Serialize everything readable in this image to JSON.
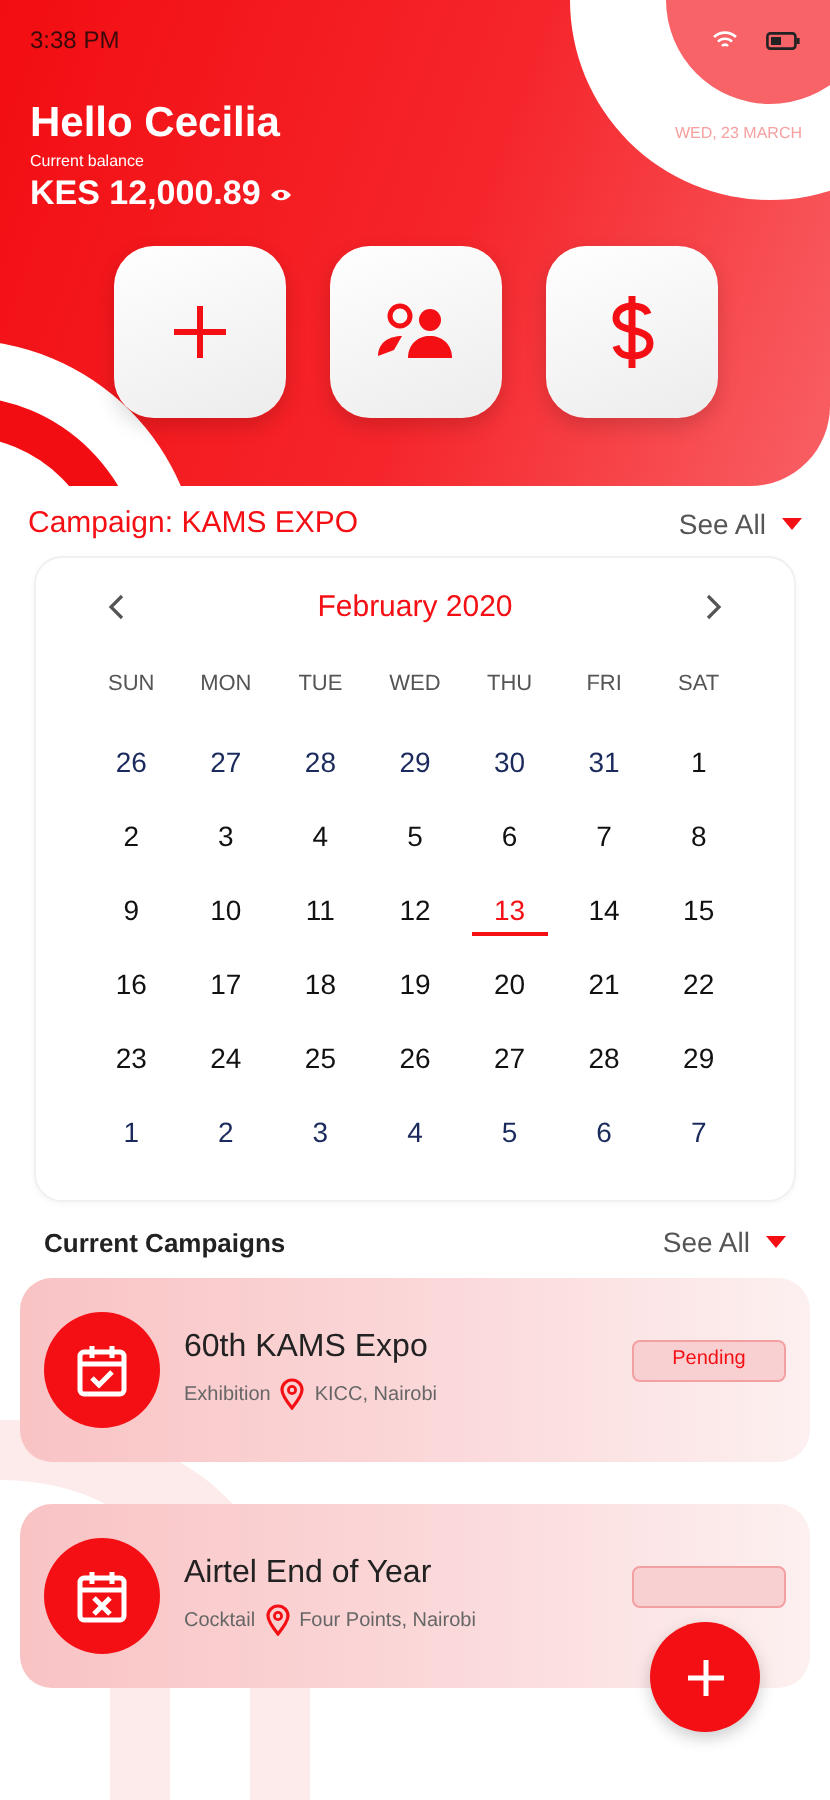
{
  "status_bar": {
    "time": "3:38 PM"
  },
  "header": {
    "greeting": "Hello Cecilia",
    "date": "WED, 23 MARCH",
    "balance_label": "Current balance",
    "balance": "KES 12,000.89"
  },
  "actions": [
    {
      "kind": "add"
    },
    {
      "kind": "people"
    },
    {
      "kind": "money"
    }
  ],
  "campaign": {
    "title": "Campaign: KAMS EXPO",
    "see_all": "See All"
  },
  "calendar": {
    "month": "February 2020",
    "weekdays": [
      "SUN",
      "MON",
      "TUE",
      "WED",
      "THU",
      "FRI",
      "SAT"
    ],
    "weeks": [
      [
        {
          "d": "26",
          "outside": true,
          "selected": false
        },
        {
          "d": "27",
          "outside": true,
          "selected": false
        },
        {
          "d": "28",
          "outside": true,
          "selected": false
        },
        {
          "d": "29",
          "outside": true,
          "selected": false
        },
        {
          "d": "30",
          "outside": true,
          "selected": false
        },
        {
          "d": "31",
          "outside": true,
          "selected": false
        },
        {
          "d": "1",
          "outside": false,
          "selected": false
        }
      ],
      [
        {
          "d": "2",
          "outside": false,
          "selected": false
        },
        {
          "d": "3",
          "outside": false,
          "selected": false
        },
        {
          "d": "4",
          "outside": false,
          "selected": false
        },
        {
          "d": "5",
          "outside": false,
          "selected": false
        },
        {
          "d": "6",
          "outside": false,
          "selected": false
        },
        {
          "d": "7",
          "outside": false,
          "selected": false
        },
        {
          "d": "8",
          "outside": false,
          "selected": false
        }
      ],
      [
        {
          "d": "9",
          "outside": false,
          "selected": false
        },
        {
          "d": "10",
          "outside": false,
          "selected": false
        },
        {
          "d": "11",
          "outside": false,
          "selected": false
        },
        {
          "d": "12",
          "outside": false,
          "selected": false
        },
        {
          "d": "13",
          "outside": false,
          "selected": true
        },
        {
          "d": "14",
          "outside": false,
          "selected": false
        },
        {
          "d": "15",
          "outside": false,
          "selected": false
        }
      ],
      [
        {
          "d": "16",
          "outside": false,
          "selected": false
        },
        {
          "d": "17",
          "outside": false,
          "selected": false
        },
        {
          "d": "18",
          "outside": false,
          "selected": false
        },
        {
          "d": "19",
          "outside": false,
          "selected": false
        },
        {
          "d": "20",
          "outside": false,
          "selected": false
        },
        {
          "d": "21",
          "outside": false,
          "selected": false
        },
        {
          "d": "22",
          "outside": false,
          "selected": false
        }
      ],
      [
        {
          "d": "23",
          "outside": false,
          "selected": false
        },
        {
          "d": "24",
          "outside": false,
          "selected": false
        },
        {
          "d": "25",
          "outside": false,
          "selected": false
        },
        {
          "d": "26",
          "outside": false,
          "selected": false
        },
        {
          "d": "27",
          "outside": false,
          "selected": false
        },
        {
          "d": "28",
          "outside": false,
          "selected": false
        },
        {
          "d": "29",
          "outside": false,
          "selected": false
        }
      ],
      [
        {
          "d": "1",
          "outside": true,
          "selected": false
        },
        {
          "d": "2",
          "outside": true,
          "selected": false
        },
        {
          "d": "3",
          "outside": true,
          "selected": false
        },
        {
          "d": "4",
          "outside": true,
          "selected": false
        },
        {
          "d": "5",
          "outside": true,
          "selected": false
        },
        {
          "d": "6",
          "outside": true,
          "selected": false
        },
        {
          "d": "7",
          "outside": true,
          "selected": false
        }
      ]
    ]
  },
  "current_campaigns": {
    "title": "Current Campaigns",
    "see_all": "See All",
    "items": [
      {
        "kind": "check",
        "name": "60th KAMS Expo",
        "type": "Exhibition",
        "location": "KICC, Nairobi",
        "status": "Pending"
      },
      {
        "kind": "cross",
        "name": "Airtel End of Year",
        "type": "Cocktail",
        "location": "Four Points, Nairobi"
      }
    ]
  }
}
